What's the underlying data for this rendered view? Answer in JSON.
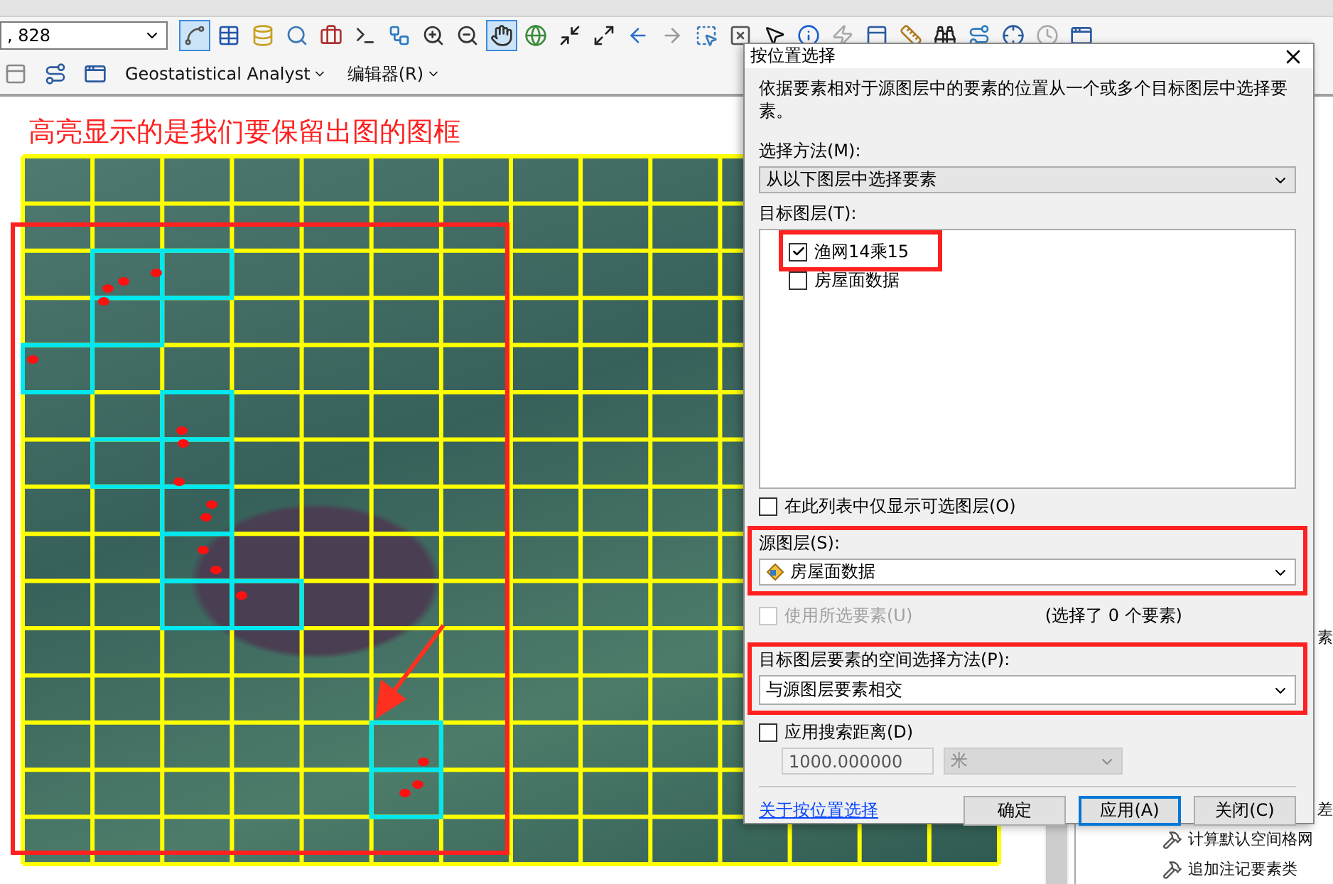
{
  "toolbar": {
    "scale_field": {
      "value": ", 828"
    },
    "tools": [
      {
        "kind": "edit-vertices",
        "selected": true
      },
      {
        "kind": "table",
        "selected": false
      },
      {
        "kind": "catalog",
        "selected": false
      },
      {
        "kind": "search-window",
        "selected": false
      },
      {
        "kind": "toolbox",
        "selected": false
      },
      {
        "kind": "python",
        "selected": false
      },
      {
        "kind": "model",
        "selected": false
      },
      {
        "kind": "zoom-in",
        "selected": false
      },
      {
        "kind": "zoom-out",
        "selected": false
      },
      {
        "kind": "pan",
        "selected": true
      },
      {
        "kind": "full-extent",
        "selected": false
      },
      {
        "kind": "zoom-in-fixed",
        "selected": false
      },
      {
        "kind": "zoom-out-fixed",
        "selected": false
      },
      {
        "kind": "back",
        "selected": false
      },
      {
        "kind": "forward",
        "selected": false
      },
      {
        "kind": "select-features",
        "selected": false
      },
      {
        "kind": "clear-selection",
        "selected": false
      },
      {
        "kind": "pointer",
        "selected": false
      },
      {
        "kind": "identify",
        "selected": false
      },
      {
        "kind": "hyperlink",
        "selected": false
      },
      {
        "kind": "html-popup",
        "selected": false
      },
      {
        "kind": "measure",
        "selected": false
      },
      {
        "kind": "find",
        "selected": false
      },
      {
        "kind": "route",
        "selected": false
      },
      {
        "kind": "goto-xy",
        "selected": false
      },
      {
        "kind": "time-slider",
        "selected": false
      },
      {
        "kind": "viewer",
        "selected": false
      }
    ],
    "menus": [
      {
        "label": "Geostatistical Analyst"
      },
      {
        "label": "编辑器(R)"
      }
    ]
  },
  "map": {
    "annotation": "高亮显示的是我们要保留出图的图框"
  },
  "dialog": {
    "title": "按位置选择",
    "description": "依据要素相对于源图层中的要素的位置从一个或多个目标图层中选择要素。",
    "method_label": "选择方法(M):",
    "method_value": "从以下图层中选择要素",
    "target_label": "目标图层(T):",
    "target_layers": [
      {
        "label": "渔网14乘15",
        "checked": true
      },
      {
        "label": "房屋面数据",
        "checked": false
      }
    ],
    "only_selectable": {
      "label": "在此列表中仅显示可选图层(O)",
      "checked": false
    },
    "source_label": "源图层(S):",
    "source_value": "房屋面数据",
    "use_selected": {
      "label": "使用所选要素(U)",
      "checked": false,
      "disabled": true
    },
    "selected_count": "(选择了 0 个要素)",
    "spatial_label": "目标图层要素的空间选择方法(P):",
    "spatial_value": "与源图层要素相交",
    "search_distance": {
      "label": "应用搜索距离(D)",
      "checked": false
    },
    "distance": {
      "value": "1000.000000",
      "disabled": true
    },
    "unit": {
      "value": "米",
      "disabled": true
    },
    "link": "关于按位置选择",
    "buttons": [
      {
        "label": "确定",
        "focused": false
      },
      {
        "label": "应用(A)",
        "focused": true
      },
      {
        "label": "关闭(C)",
        "focused": false
      }
    ]
  },
  "toolbox": {
    "items": [
      {
        "kind": "clipped",
        "label": "素"
      },
      {
        "kind": "clipped",
        "label": "差"
      },
      {
        "kind": "tool",
        "label": "计算默认空间格网"
      },
      {
        "kind": "tool",
        "label": "追加注记要素类"
      }
    ]
  }
}
